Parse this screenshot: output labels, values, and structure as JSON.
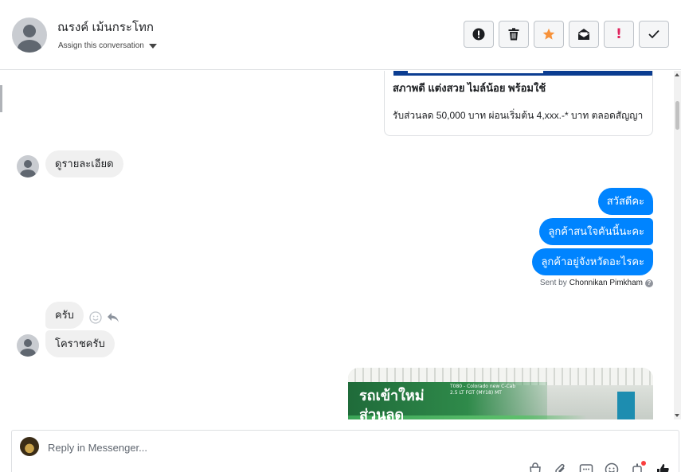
{
  "header": {
    "contact_name": "ณรงค์ เม้นกระโทก",
    "assign_label": "Assign this conversation",
    "toolbar": [
      {
        "name": "spam-button",
        "icon": "alert-circle-icon"
      },
      {
        "name": "delete-button",
        "icon": "trash-icon"
      },
      {
        "name": "star-button",
        "icon": "star-icon",
        "color": "#f7923a"
      },
      {
        "name": "mark-unread-button",
        "icon": "envelope-open-icon"
      },
      {
        "name": "important-button",
        "icon": "exclamation-icon",
        "color": "#e0245e"
      },
      {
        "name": "done-button",
        "icon": "checkmark-icon"
      }
    ]
  },
  "messages": {
    "card1": {
      "title": "สภาพดี แต่งสวย ไมล์น้อย พร้อมใช้",
      "subtitle": "รับส่วนลด 50,000 บาท ผ่อนเริ่มต้น 4,xxx.-* บาท ตลอดสัญญา"
    },
    "in1": "ดูรายละเอียด",
    "out": [
      "สวัสดีคะ",
      "ลูกค้าสนใจคันนี้นะคะ",
      "ลูกค้าอยู่จังหวัดอะไรคะ"
    ],
    "sent_by_prefix": "Sent by",
    "sent_by_name": "Chonnikan Pimkham",
    "in2": "ครับ",
    "in3": "โคราชครับ",
    "card2": {
      "line1": "รถเข้าใหม่",
      "line2": "ส่วนลด",
      "small_line1": "T080 - Colorado new C-Cab",
      "small_line2": "2.5 LT FGT (MY18) MT"
    }
  },
  "composer": {
    "placeholder": "Reply in Messenger...",
    "icons": [
      "shopping-bag-icon",
      "paperclip-icon",
      "saved-reply-icon",
      "emoji-icon",
      "bot-icon",
      "thumbs-up-icon"
    ]
  }
}
